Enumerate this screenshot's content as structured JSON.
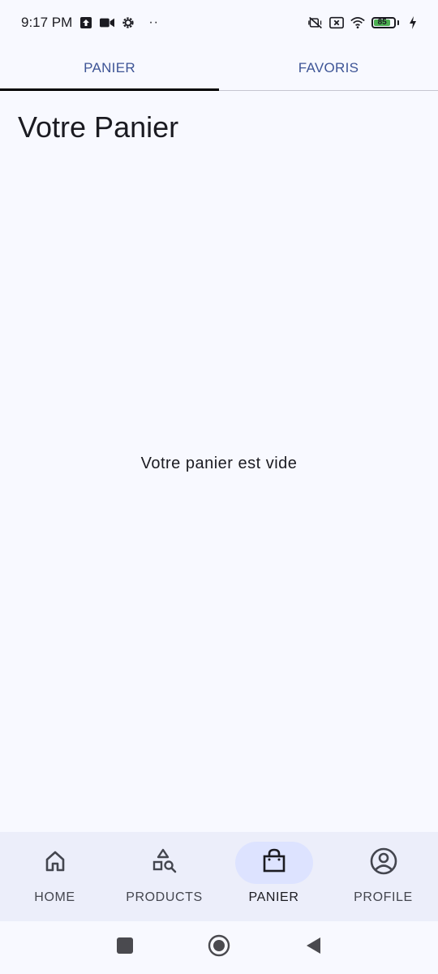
{
  "status_bar": {
    "time": "9:17 PM",
    "battery_level": "85",
    "icons": [
      "upload-notification-icon",
      "video-camera-icon",
      "settings-gear-icon",
      "vibrate-off-icon",
      "sim-x-icon",
      "wifi-icon",
      "battery-icon",
      "charging-bolt-icon"
    ],
    "more_dots": "··"
  },
  "top_tabs": {
    "items": [
      {
        "label": "PANIER",
        "active": true
      },
      {
        "label": "FAVORIS",
        "active": false
      }
    ]
  },
  "main": {
    "title": "Votre Panier",
    "empty_message": "Votre panier est vide"
  },
  "bottom_nav": {
    "items": [
      {
        "label": "HOME",
        "icon": "home-icon",
        "active": false
      },
      {
        "label": "PRODUCTS",
        "icon": "products-shapes-search-icon",
        "active": false
      },
      {
        "label": "PANIER",
        "icon": "shopping-bag-icon",
        "active": true
      },
      {
        "label": "PROFILE",
        "icon": "account-circle-icon",
        "active": false
      }
    ]
  },
  "colors": {
    "background": "#f8f9ff",
    "tab_text": "#3e5596",
    "tab_indicator": "#000000",
    "nav_background": "#eceefa",
    "nav_active_pill": "#dde3ff",
    "battery_fill": "#4caf50"
  }
}
